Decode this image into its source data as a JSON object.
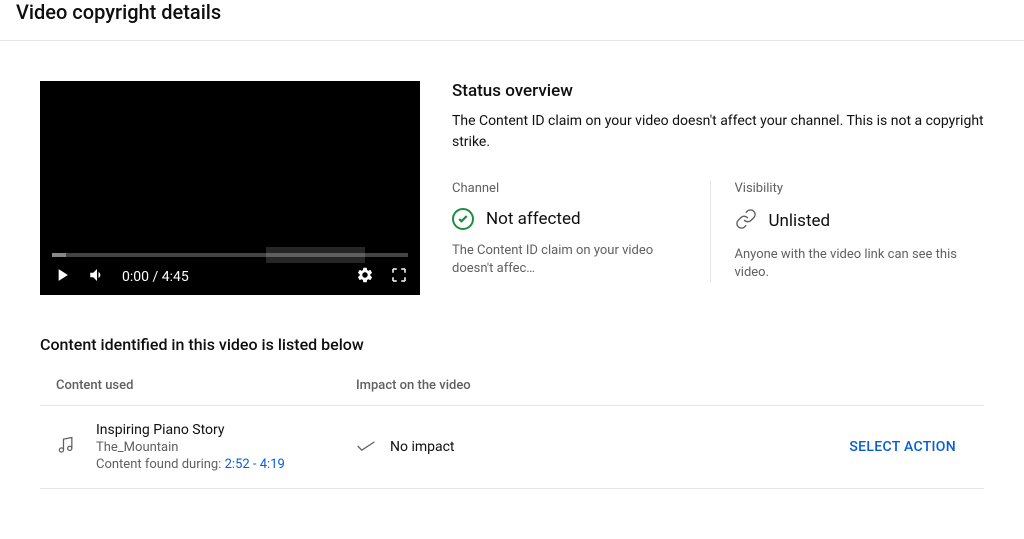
{
  "header": {
    "title": "Video copyright details"
  },
  "player": {
    "time": "0:00 / 4:45"
  },
  "status": {
    "title": "Status overview",
    "description": "The Content ID claim on your video doesn't affect your channel. This is not a copyright strike.",
    "channel": {
      "label": "Channel",
      "value": "Not affected",
      "description": "The Content ID claim on your video doesn't affec…"
    },
    "visibility": {
      "label": "Visibility",
      "value": "Unlisted",
      "description": "Anyone with the video link can see this video."
    }
  },
  "content": {
    "section_title": "Content identified in this video is listed below",
    "columns": {
      "content_used": "Content used",
      "impact": "Impact on the video"
    },
    "items": [
      {
        "title": "Inspiring Piano Story",
        "artist": "The_Mountain",
        "duration_prefix": "Content found during: ",
        "duration_time": "2:52 - 4:19",
        "impact": "No impact",
        "action": "SELECT ACTION"
      }
    ]
  }
}
